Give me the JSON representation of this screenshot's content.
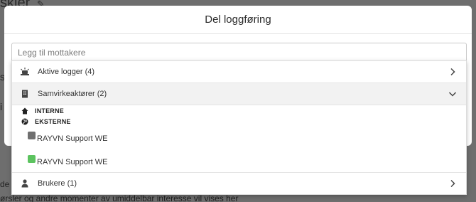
{
  "background": {
    "title_fragment": "skier",
    "text_fragment_1": "s",
    "text_fragment_2": "i",
    "text_fragment_3": "de o",
    "text_fragment_4": "ørsler og andre momenter av umiddelbar interesse vil vises her",
    "pencil_icon": "pencil-icon"
  },
  "modal": {
    "title": "Del loggføring"
  },
  "recipient_input": {
    "value": "",
    "placeholder": "Legg til mottakere"
  },
  "dropdown": {
    "groups": [
      {
        "label": "Aktive logger (4)",
        "icon": "incident-icon",
        "expanded": false
      },
      {
        "label": "Samvirkeaktører (2)",
        "icon": "building-icon",
        "expanded": true
      },
      {
        "label": "Brukere (1)",
        "icon": "person-icon",
        "expanded": false
      }
    ],
    "subgroups": [
      {
        "label": "INTERNE",
        "icon": "home-icon"
      },
      {
        "label": "EKSTERNE",
        "icon": "globe-icon"
      }
    ],
    "members": [
      {
        "label": "RAYVN Support WE",
        "color": "#6f6f6f"
      },
      {
        "label": "RAYVN Support WE",
        "color": "#5cc35f"
      }
    ]
  },
  "colors": {
    "overlay": "#6e6e6e",
    "modal_bg": "#ffffff",
    "active_row": "#f2f2f2"
  }
}
